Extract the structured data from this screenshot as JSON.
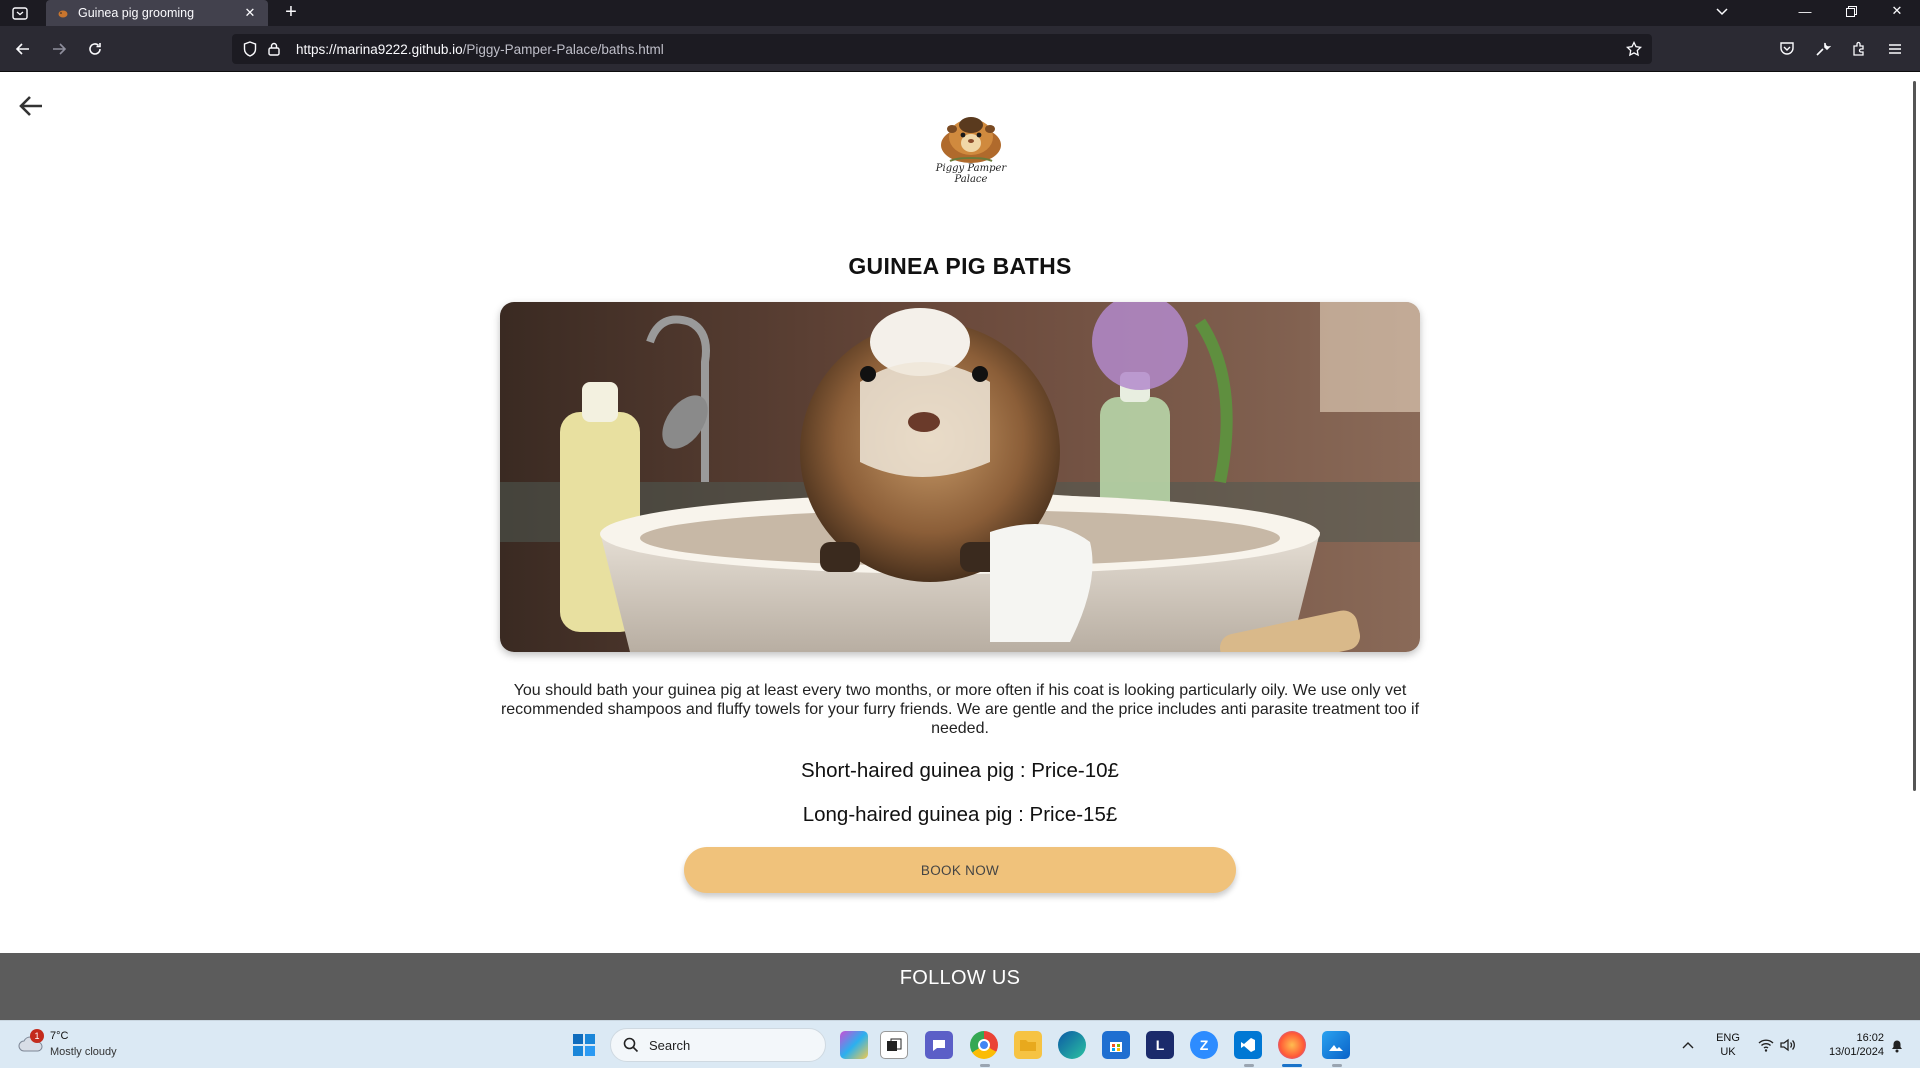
{
  "browser": {
    "tab_title": "Guinea pig grooming",
    "url_domain": "https://marina9222.github.io",
    "url_path": "/Piggy-Pamper-Palace/baths.html"
  },
  "page": {
    "logo_text": "Piggy Pamper Palace",
    "title": "GUINEA PIG BATHS",
    "description": "You should bath your guinea pig at least every two months, or more often if his coat is looking particularly oily. We use only vet recommended shampoos and fluffy towels for your furry friends. We are gentle and the price includes anti parasite treatment too if needed.",
    "prices": [
      "Short-haired guinea pig : Price-10£",
      "Long-haired guinea pig : Price-15£"
    ],
    "book_button": "BOOK NOW",
    "footer_title": "FOLLOW US"
  },
  "taskbar": {
    "weather_temp": "7°C",
    "weather_condition": "Mostly cloudy",
    "notification_count": "1",
    "search_label": "Search",
    "language_top": "ENG",
    "language_bottom": "UK",
    "time": "16:02",
    "date": "13/01/2024"
  },
  "colors": {
    "book_button": "#f0c27b",
    "footer": "#5c5c5c",
    "browser_chrome": "#2b2a33"
  }
}
